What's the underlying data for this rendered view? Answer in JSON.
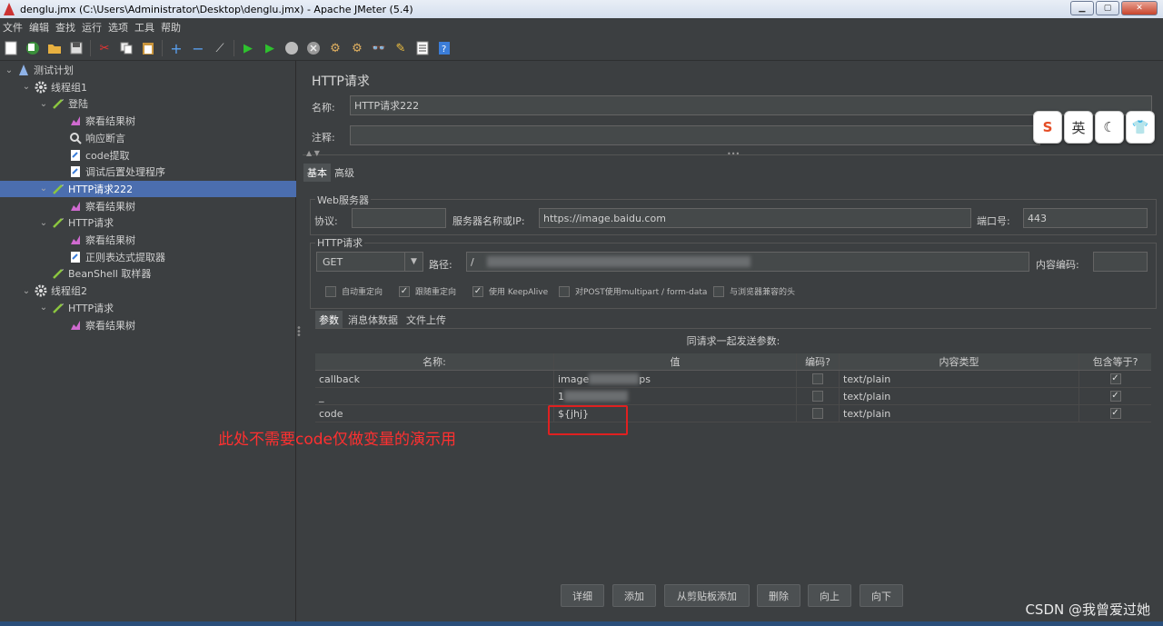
{
  "window": {
    "title": "denglu.jmx (C:\\Users\\Administrator\\Desktop\\denglu.jmx) - Apache JMeter (5.4)",
    "minimize": "▁",
    "maximize": "▢",
    "close": "✕"
  },
  "menu": [
    "文件",
    "编辑",
    "查找",
    "运行",
    "选项",
    "工具",
    "帮助"
  ],
  "toolbar_icons": [
    "new-icon",
    "templates-icon",
    "open-icon",
    "save-icon",
    "cut-icon",
    "copy-icon",
    "paste-icon",
    "expand-icon",
    "collapse-icon",
    "toggle-icon",
    "start-icon",
    "start-no-pause-icon",
    "stop-icon",
    "shutdown-icon",
    "clear-icon",
    "clear-all-icon",
    "search-icon",
    "reset-search-icon",
    "function-helper-icon",
    "help-icon"
  ],
  "tree": [
    {
      "label": "测试计划",
      "level": 0,
      "icon": "test-plan-icon",
      "toggle": "v",
      "selected": false
    },
    {
      "label": "线程组1",
      "level": 1,
      "icon": "thread-group-icon",
      "toggle": "v",
      "selected": false
    },
    {
      "label": "登陆",
      "level": 2,
      "icon": "sampler-icon",
      "toggle": "v",
      "selected": false
    },
    {
      "label": "察看结果树",
      "level": 3,
      "icon": "listener-icon",
      "toggle": "",
      "selected": false
    },
    {
      "label": "响应断言",
      "level": 3,
      "icon": "assertion-icon",
      "toggle": "",
      "selected": false
    },
    {
      "label": "code提取",
      "level": 3,
      "icon": "extractor-icon",
      "toggle": "",
      "selected": false
    },
    {
      "label": "调试后置处理程序",
      "level": 3,
      "icon": "postprocessor-icon",
      "toggle": "",
      "selected": false
    },
    {
      "label": "HTTP请求222",
      "level": 2,
      "icon": "sampler-icon",
      "toggle": "v",
      "selected": true
    },
    {
      "label": "察看结果树",
      "level": 3,
      "icon": "listener-icon",
      "toggle": "",
      "selected": false
    },
    {
      "label": "HTTP请求",
      "level": 2,
      "icon": "sampler-icon",
      "toggle": "v",
      "selected": false
    },
    {
      "label": "察看结果树",
      "level": 3,
      "icon": "listener-icon",
      "toggle": "",
      "selected": false
    },
    {
      "label": "正则表达式提取器",
      "level": 3,
      "icon": "extractor-icon",
      "toggle": "",
      "selected": false
    },
    {
      "label": "BeanShell 取样器",
      "level": 2,
      "icon": "sampler-icon",
      "toggle": "",
      "selected": false
    },
    {
      "label": "线程组2",
      "level": 1,
      "icon": "thread-group-icon",
      "toggle": "v",
      "selected": false
    },
    {
      "label": "HTTP请求",
      "level": 2,
      "icon": "sampler-icon",
      "toggle": "v",
      "selected": false
    },
    {
      "label": "察看结果树",
      "level": 3,
      "icon": "listener-icon",
      "toggle": "",
      "selected": false
    }
  ],
  "panel": {
    "title": "HTTP请求",
    "name_label": "名称:",
    "name_value": "HTTP请求222",
    "comment_label": "注释:",
    "comment_value": "",
    "tab_basic": "基本",
    "tab_advanced": "高级",
    "web_server_title": "Web服务器",
    "protocol_label": "协议:",
    "protocol_value": "",
    "server_label": "服务器名称或IP:",
    "server_value": "https://image.baidu.com",
    "port_label": "端口号:",
    "port_value": "443",
    "http_request_title": "HTTP请求",
    "method_value": "GET",
    "path_label": "路径:",
    "path_value": "/",
    "encoding_label": "内容编码:",
    "encoding_value": "",
    "checkboxes": [
      {
        "label": "自动重定向",
        "checked": false,
        "mark": ""
      },
      {
        "label": "跟随重定向",
        "checked": true,
        "mark": "✓"
      },
      {
        "label": "使用 KeepAlive",
        "checked": true,
        "mark": "✓"
      },
      {
        "label": "对POST使用multipart / form-data",
        "checked": false,
        "mark": ""
      },
      {
        "label": "与浏览器兼容的头",
        "checked": false,
        "mark": ""
      }
    ],
    "subtabs": [
      "参数",
      "消息体数据",
      "文件上传"
    ],
    "table_caption": "同请求一起发送参数:",
    "table_headers": [
      "名称:",
      "值",
      "编码?",
      "内容类型",
      "包含等于?"
    ],
    "rows": [
      {
        "name": "callback",
        "value_start": "image",
        "value_end": "ps",
        "encode": false,
        "content_type": "text/plain",
        "include_equals": true,
        "mark": "✓"
      },
      {
        "name": "_",
        "value_start": "1",
        "value_end": "",
        "encode": false,
        "content_type": "text/plain",
        "include_equals": true,
        "mark": "✓"
      },
      {
        "name": "code",
        "value_start": "${jhj}",
        "value_end": "",
        "encode": false,
        "content_type": "text/plain",
        "include_equals": true,
        "mark": "✓"
      }
    ],
    "annotation": "此处不需要code仅做变量的演示用",
    "buttons": [
      "详细",
      "添加",
      "从剪贴板添加",
      "删除",
      "向上",
      "向下"
    ]
  },
  "widget": [
    "S",
    "英",
    "☾",
    "👕"
  ],
  "watermark": "CSDN @我曾爱过她",
  "colors": {
    "accent": "#4b6eaf",
    "annotation": "#ff3030",
    "background": "#3c3f41"
  }
}
